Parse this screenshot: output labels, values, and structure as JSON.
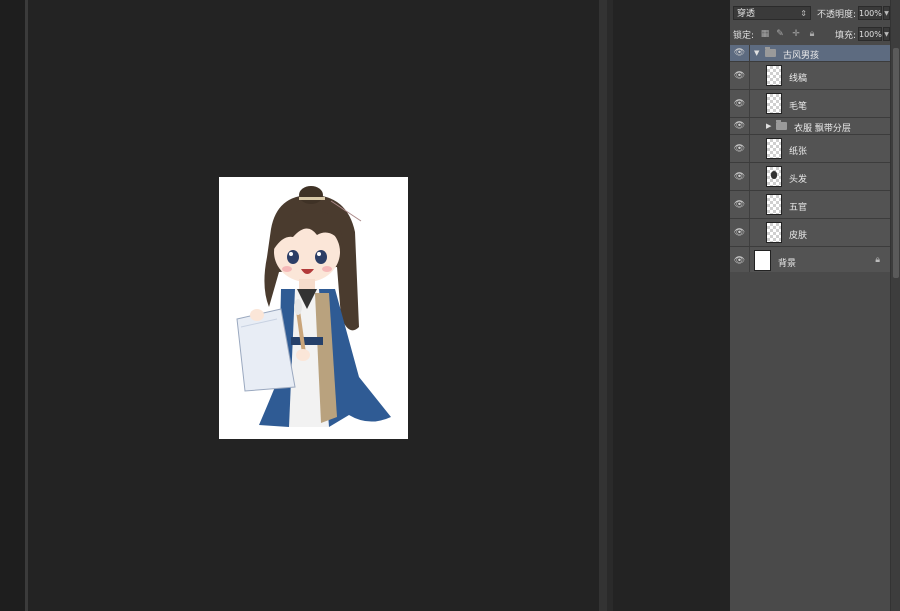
{
  "layers_panel": {
    "blend_mode": "穿透",
    "opacity_label": "不透明度:",
    "opacity_value": "100%",
    "lock_label": "锁定:",
    "fill_label": "填充:",
    "fill_value": "100%",
    "group_name": "古风男孩",
    "layers": [
      {
        "name": "线稿",
        "kind": "layer"
      },
      {
        "name": "毛笔",
        "kind": "layer"
      },
      {
        "name": "衣服 飘带分层",
        "kind": "group"
      },
      {
        "name": "纸张",
        "kind": "layer"
      },
      {
        "name": "头发",
        "kind": "layer"
      },
      {
        "name": "五官",
        "kind": "layer"
      },
      {
        "name": "皮肤",
        "kind": "layer"
      }
    ],
    "background_layer": "背景"
  },
  "icons": {
    "visibility": "eye-icon",
    "folder": "folder-icon",
    "lock": "lock-icon"
  },
  "colors": {
    "workspace": "#232323",
    "panel": "#535353",
    "selected_row": "#5d6b80"
  }
}
